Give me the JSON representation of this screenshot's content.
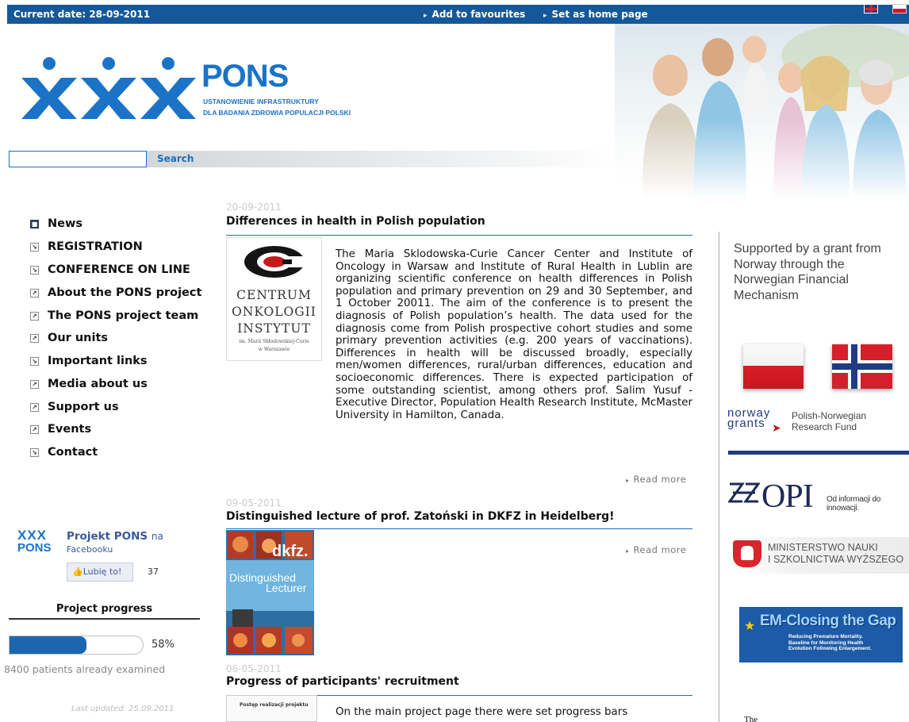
{
  "topbar": {
    "date_label": "Current date: 28-09-2011",
    "add_favourites": "Add to favourites",
    "set_home": "Set as home page",
    "lang_english_icon": "uk-flag-icon",
    "lang_polish_icon": "pl-flag-icon"
  },
  "header": {
    "logo_text": "PONS",
    "logo_subtitle_line1": "USTANOWIENIE INFRASTRUKTURY",
    "logo_subtitle_line2": "DLA BADANIA ZDROWIA POPULACJI POLSKI"
  },
  "search": {
    "button_label": "Search",
    "value": ""
  },
  "nav": {
    "items": [
      {
        "label": "News",
        "icon": "square-bullet-icon",
        "active": true
      },
      {
        "label": "REGISTRATION",
        "icon": "arrow-down-right-icon"
      },
      {
        "label": "CONFERENCE ON LINE",
        "icon": "arrow-down-right-icon"
      },
      {
        "label": "About the PONS project",
        "icon": "arrow-up-right-icon"
      },
      {
        "label": "The PONS project team",
        "icon": "arrow-up-right-icon"
      },
      {
        "label": "Our units",
        "icon": "arrow-up-right-icon"
      },
      {
        "label": "Important links",
        "icon": "arrow-down-right-icon"
      },
      {
        "label": "Media about us",
        "icon": "arrow-up-right-icon"
      },
      {
        "label": "Support us",
        "icon": "arrow-up-right-icon"
      },
      {
        "label": "Events",
        "icon": "arrow-up-right-icon"
      },
      {
        "label": "Contact",
        "icon": "arrow-down-right-icon"
      }
    ]
  },
  "facebook": {
    "title": "Projekt PONS",
    "title_suffix": "na",
    "subtitle": "Facebooku",
    "like_label": "Lubię to!",
    "like_count": "37",
    "logo_text_top": "XXX",
    "logo_text_bottom": "PONS"
  },
  "progress": {
    "title": "Project progress",
    "percent": 58,
    "percent_label": "58%",
    "examined": "8400 patients already examined",
    "updated": "Last updated: 25.09.2011",
    "bar_color": "#1e65b0"
  },
  "articles": [
    {
      "date": "20-09-2011",
      "title": "Differences in health in Polish population",
      "body": "The Maria Sklodowska-Curie Cancer Center and Institute of Oncology in Warsaw and Institute of Rural Health in Lublin are organizing scientific conference on health differences in Polish population and primary prevention on 29 and 30 September, and 1 October 20011. The aim of the conference is to present the diagnosis of Polish population’s health. The data used for the diagnosis come from Polish prospective cohort studies and some primary prevention activities (e.g. 200 years of vaccinations). Differences in health will be discussed broadly, especially men/women differences, rural/urban differences, education and socioeconomic differences. There is expected participation of some outstanding scientist, among others prof. Salim Yusuf - Executive Director, Population Health Research Institute, McMaster University in Hamilton, Canada.",
      "read_more": "Read more",
      "image_line1": "CENTRUM",
      "image_line2": "ONKOLOGII",
      "image_line3": "INSTYTUT",
      "image_small1": "im. Marii Skłodowskiej-Curie",
      "image_small2": "w Warszawie"
    },
    {
      "date": "09-05-2011",
      "title": "Distinguished lecture of prof. Zatoński in DKFZ in Heidelberg!",
      "read_more": "Read more",
      "image_text1": "dkfz.",
      "image_text2": "Distinguished",
      "image_text3": "Lecturer"
    },
    {
      "date": "06-05-2011",
      "title": "Progress of participants' recruitment",
      "body": "On the main project page there were set progress bars",
      "image_text": "Postęp realizacji projektu"
    }
  ],
  "sidebar": {
    "support_text": "Supported by a grant from Norway through the Norwegian Financial Mechanism",
    "norway_grants_mark": "norway grants",
    "norway_grants_text_line1": "Polish-Norwegian",
    "norway_grants_text_line2": "Research Fund",
    "opi_logo": "OPI",
    "opi_tagline": "Od informacji do innowacji.",
    "ministry_line1": "MINISTERSTWO NAUKI",
    "ministry_line2": "I SZKOLNICTWA WYŻSZEGO",
    "em_title": "EM-Closing the Gap",
    "em_sub_line1": "Reducing Premature Mortality.",
    "em_sub_line2": "Baseline for Monitoring Health",
    "em_sub_line3": "Evolution Following Enlargement.",
    "bottom_text": "The"
  },
  "colors": {
    "topbar": "#15589a",
    "brand_blue": "#1a73c7",
    "link_blue": "#1a6fbb",
    "facebook_blue": "#3b5998"
  }
}
